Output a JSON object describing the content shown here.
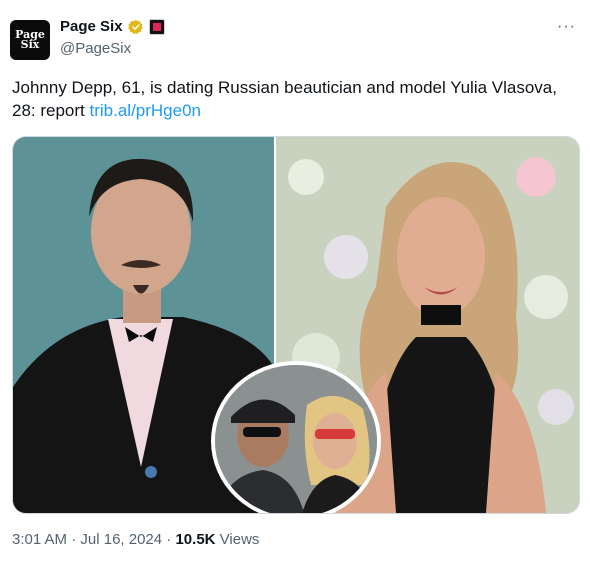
{
  "account": {
    "avatar_line1": "Page",
    "avatar_line2": "Six",
    "display_name": "Page Six",
    "handle": "@PageSix",
    "more_label": "···"
  },
  "tweet": {
    "text": "Johnny Depp, 61, is dating Russian beautician and model Yulia Vlasova, 28: report ",
    "link": "trib.al/prHge0n"
  },
  "meta": {
    "time": "3:01 AM",
    "separator1": " · ",
    "date": "Jul 16, 2024",
    "separator2": " · ",
    "views_count": "10.5K",
    "views_label": " Views"
  },
  "colors": {
    "link": "#1d9bf0",
    "verified_gold": "#e2b719",
    "secondary_text": "#536471"
  },
  "icons": [
    "verified-badge-icon",
    "affiliate-badge-icon",
    "more-options-icon"
  ]
}
